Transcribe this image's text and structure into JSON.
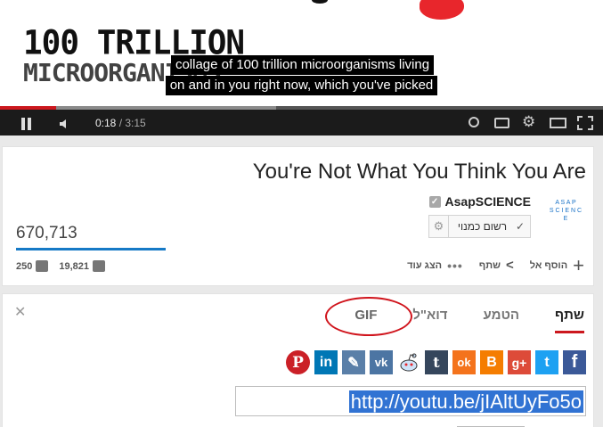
{
  "video": {
    "handwritten_title": "100 TRILLION",
    "handwritten_sub": "MICROORGANISMS",
    "caption_line1": "collage of 100 trillion microorganisms living",
    "caption_line2": "on and in you right now, which you've picked",
    "time_current": "0:18",
    "time_separator": " / ",
    "time_duration": "3:15",
    "progress_played": 0.093,
    "progress_loaded": 0.458
  },
  "info": {
    "title": "You're Not What You Think You Are",
    "channel": "AsapSCIENCE",
    "subscribe_label": "רשום כמנוי",
    "views": "670,713",
    "likes": "19,821",
    "dislikes": "250",
    "add_to_label": "הוסף אל",
    "share_label": "שתף",
    "more_label": "הצג עוד"
  },
  "share_panel": {
    "tabs": [
      {
        "label": "שתף",
        "active": true
      },
      {
        "label": "הטמע",
        "active": false
      },
      {
        "label": "דוא\"ל",
        "active": false
      },
      {
        "label": "GIF",
        "active": false
      }
    ],
    "url": "http://youtu.be/jIAltUyFo5o",
    "socials": [
      {
        "name": "facebook-icon",
        "label": "f",
        "color": "#3b5998"
      },
      {
        "name": "twitter-icon",
        "label": "t",
        "color": "#1da1f2"
      },
      {
        "name": "google-plus-icon",
        "label": "g+",
        "color": "#dd4b39"
      },
      {
        "name": "blogger-icon",
        "label": "B",
        "color": "#f57d00"
      },
      {
        "name": "odnoklassniki-icon",
        "label": "ok",
        "color": "#f4731c"
      },
      {
        "name": "tumblr-icon",
        "label": "t",
        "color": "#35465c"
      },
      {
        "name": "reddit-icon",
        "label": "r",
        "color": "#cee3f8"
      },
      {
        "name": "vk-icon",
        "label": "vk",
        "color": "#4c75a3"
      },
      {
        "name": "livejournal-icon",
        "label": "✎",
        "color": "#5a7fa8"
      },
      {
        "name": "linkedin-icon",
        "label": "in",
        "color": "#0077b5"
      },
      {
        "name": "pinterest-icon",
        "label": "P",
        "color": "#cb2027"
      }
    ]
  }
}
